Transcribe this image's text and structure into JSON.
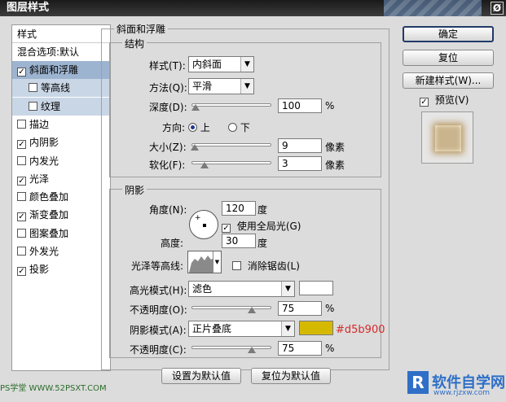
{
  "window": {
    "title": "图层样式",
    "close_glyph": "Ø"
  },
  "left_panel": {
    "header": "样式",
    "blend_options": "混合选项:默认",
    "items": [
      {
        "label": "斜面和浮雕",
        "checked": true,
        "selected": true
      },
      {
        "label": "等高线",
        "checked": false,
        "sub": true
      },
      {
        "label": "纹理",
        "checked": false,
        "sub": true
      },
      {
        "label": "描边",
        "checked": false
      },
      {
        "label": "内阴影",
        "checked": true
      },
      {
        "label": "内发光",
        "checked": false
      },
      {
        "label": "光泽",
        "checked": true
      },
      {
        "label": "颜色叠加",
        "checked": false
      },
      {
        "label": "渐变叠加",
        "checked": true
      },
      {
        "label": "图案叠加",
        "checked": false
      },
      {
        "label": "外发光",
        "checked": false
      },
      {
        "label": "投影",
        "checked": true
      }
    ]
  },
  "bevel": {
    "section_title": "斜面和浮雕",
    "structure_title": "结构",
    "style_label": "样式(T):",
    "style_value": "内斜面",
    "technique_label": "方法(Q):",
    "technique_value": "平滑",
    "depth_label": "深度(D):",
    "depth_value": "100",
    "depth_unit": "%",
    "depth_level": 0.05,
    "direction_label": "方向:",
    "dir_up": "上",
    "dir_down": "下",
    "size_label": "大小(Z):",
    "size_value": "9",
    "size_unit": "像素",
    "size_level": 0.04,
    "soften_label": "软化(F):",
    "soften_value": "3",
    "soften_unit": "像素",
    "soften_level": 0.16
  },
  "shading": {
    "title": "阴影",
    "angle_label": "角度(N):",
    "angle_value": "120",
    "angle_unit": "度",
    "global_light_label": "使用全局光(G)",
    "altitude_label": "高度:",
    "altitude_value": "30",
    "altitude_unit": "度",
    "gloss_contour_label": "光泽等高线:",
    "anti_alias_label": "消除锯齿(L)",
    "highlight_mode_label": "高光模式(H):",
    "highlight_mode_value": "滤色",
    "highlight_color": "#ffffff",
    "highlight_opacity_label": "不透明度(O):",
    "highlight_opacity_value": "75",
    "highlight_opacity_level": 0.75,
    "shadow_mode_label": "阴影模式(A):",
    "shadow_mode_value": "正片叠底",
    "shadow_color": "#d5b900",
    "shadow_color_label": "#d5b900",
    "shadow_opacity_label": "不透明度(C):",
    "shadow_opacity_value": "75",
    "shadow_opacity_level": 0.75,
    "percent": "%"
  },
  "buttons": {
    "ok": "确定",
    "reset": "复位",
    "new_style": "新建样式(W)...",
    "preview_label": "预览(V)",
    "make_default": "设置为默认值",
    "reset_default": "复位为默认值"
  },
  "watermark": {
    "left": "PS学堂 WWW.52PSXT.COM",
    "right_logo": "R",
    "right_text": "软件自学网",
    "right_url": "www.rjzxw.com"
  }
}
